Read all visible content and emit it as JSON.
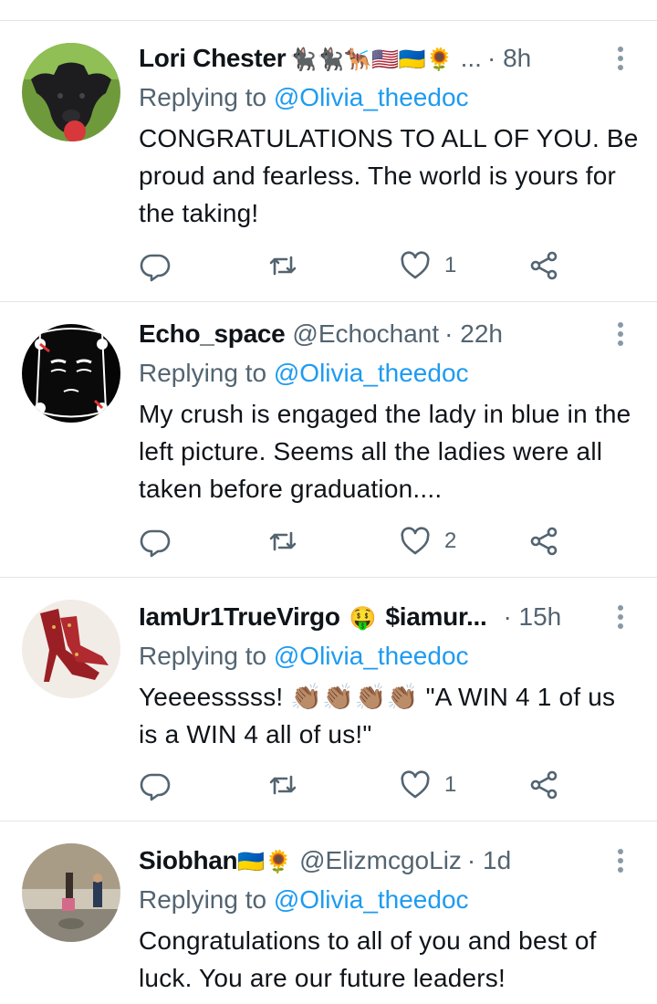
{
  "replying_prefix": "Replying to",
  "tweets": [
    {
      "name": "Lori Chester",
      "emojis": "🐈‍⬛🐈‍⬛🐕‍🦺🇺🇸🇺🇦🌻",
      "handle": "",
      "ellipsis": "...",
      "time": "· 8h",
      "replying_to": "@Olivia_theedoc",
      "text": "CONGRATULATIONS TO ALL OF YOU. Be proud and fearless.  The world is yours for the taking!",
      "reply_count": "",
      "retweet_count": "",
      "like_count": "1"
    },
    {
      "name": "Echo_space",
      "emojis": "",
      "handle": "@Echochant",
      "ellipsis": "",
      "time": "· 22h",
      "replying_to": "@Olivia_theedoc",
      "text": "My crush is engaged the lady in blue in the left picture. Seems all the ladies were all taken before graduation....",
      "reply_count": "",
      "retweet_count": "",
      "like_count": "2"
    },
    {
      "name": "IamUr1TrueVirgo",
      "emojis": "🤑",
      "handle": "$iamur...",
      "ellipsis": "",
      "time": "· 15h",
      "replying_to": "@Olivia_theedoc",
      "text": "Yeeeesssss! 👏🏽👏🏽👏🏽👏🏽 \"A WIN 4 1 of us is a WIN 4 all of us!\"",
      "reply_count": "",
      "retweet_count": "",
      "like_count": "1"
    },
    {
      "name": "Siobhan",
      "emojis": "🇺🇦🌻",
      "handle": "@ElizmcgoLiz",
      "ellipsis": "",
      "time": "· 1d",
      "replying_to": "@Olivia_theedoc",
      "text": "Congratulations to all of you and best of luck. You are our future leaders!",
      "reply_count": "",
      "retweet_count": "",
      "like_count": ""
    }
  ],
  "colors": {
    "text": "#0f1419",
    "muted": "#536471",
    "link": "#1d9bf0",
    "divider": "#e3e6e9"
  },
  "icons": [
    "reply-icon",
    "retweet-icon",
    "like-icon",
    "share-icon",
    "more-icon"
  ]
}
